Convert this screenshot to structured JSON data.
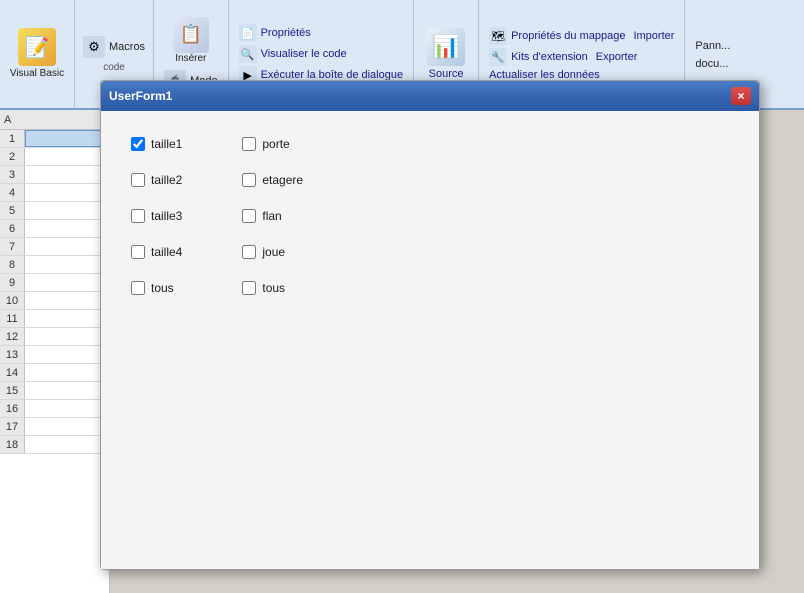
{
  "ribbon": {
    "groups": [
      {
        "id": "code",
        "label": "Code",
        "items": [
          {
            "id": "visual-basic",
            "label": "Visual\nBasic",
            "icon": "📝"
          },
          {
            "id": "macros",
            "label": "Macros",
            "icon": "⚙"
          }
        ]
      },
      {
        "id": "insert",
        "label": "",
        "items": [
          {
            "id": "insert",
            "label": "Insérer",
            "icon": "📋"
          },
          {
            "id": "mode",
            "label": "Mode",
            "icon": "🖱"
          }
        ]
      },
      {
        "id": "properties-group",
        "label": "",
        "items": [
          {
            "id": "proprietes",
            "label": "Propriétés",
            "icon": "📄"
          },
          {
            "id": "visualiser",
            "label": "Visualiser le code",
            "icon": "🔍"
          },
          {
            "id": "executer",
            "label": "Exécuter la boîte de dialogue",
            "icon": "▶"
          }
        ]
      },
      {
        "id": "source-group",
        "label": "",
        "items": [
          {
            "id": "source",
            "label": "Source",
            "icon": "📊"
          }
        ]
      },
      {
        "id": "mapping-group",
        "label": "",
        "items": [
          {
            "id": "proprietes-mappage",
            "label": "Propriétés du mappage",
            "icon": "🗺"
          },
          {
            "id": "kits-extension",
            "label": "Kits d'extension",
            "icon": "🔧"
          },
          {
            "id": "actualiser",
            "label": "Actualiser les données",
            "icon": "🔄"
          },
          {
            "id": "importer",
            "label": "Importer",
            "icon": "📥"
          },
          {
            "id": "exporter",
            "label": "Exporter",
            "icon": "📤"
          }
        ]
      },
      {
        "id": "pann-group",
        "label": "",
        "items": [
          {
            "id": "pann",
            "label": "Pann...",
            "icon": "📌"
          },
          {
            "id": "docu",
            "label": "docu...",
            "icon": "📄"
          }
        ]
      }
    ]
  },
  "dialog": {
    "title": "UserForm1",
    "close_button_label": "×",
    "checkboxes_left": [
      {
        "id": "taille1",
        "label": "taille1",
        "checked": true
      },
      {
        "id": "taille2",
        "label": "taille2",
        "checked": false
      },
      {
        "id": "taille3",
        "label": "taille3",
        "checked": false
      },
      {
        "id": "taille4",
        "label": "taille4",
        "checked": false
      },
      {
        "id": "tous-left",
        "label": "tous",
        "checked": false
      }
    ],
    "checkboxes_right": [
      {
        "id": "porte",
        "label": "porte",
        "checked": false
      },
      {
        "id": "etagere",
        "label": "etagere",
        "checked": false
      },
      {
        "id": "flan",
        "label": "flan",
        "checked": false
      },
      {
        "id": "joue",
        "label": "joue",
        "checked": false
      },
      {
        "id": "tous-right",
        "label": "tous",
        "checked": false
      }
    ]
  },
  "spreadsheet": {
    "header": "A",
    "rows": [
      1,
      2,
      3,
      4,
      5,
      6,
      7,
      8,
      9,
      10,
      11,
      12,
      13,
      14,
      15,
      16,
      17,
      18
    ],
    "selected_row": 1
  }
}
